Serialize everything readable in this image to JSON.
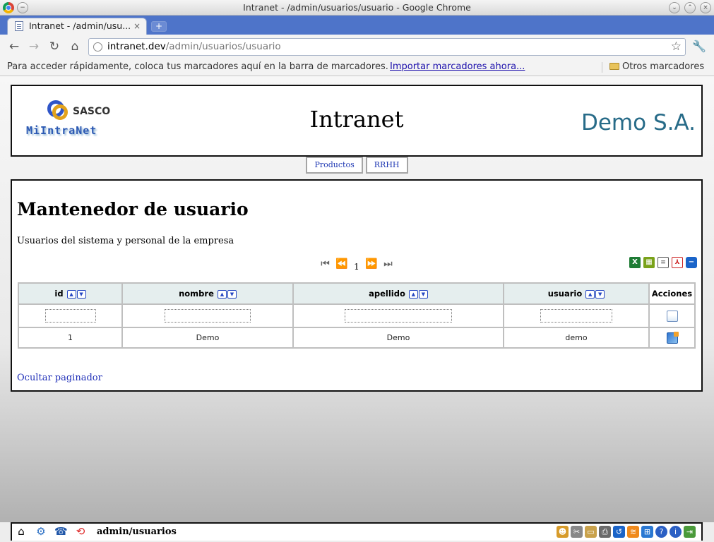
{
  "window": {
    "title": "Intranet - /admin/usuarios/usuario - Google Chrome"
  },
  "tab": {
    "label": "Intranet - /admin/usu...",
    "close": "×",
    "new_tab": "+"
  },
  "omnibox": {
    "host": "intranet.dev",
    "path": "/admin/usuarios/usuario"
  },
  "bookmarks": {
    "hint": "Para acceder rápidamente, coloca tus marcadores aquí en la barra de marcadores.",
    "import_link": "Importar marcadores ahora...",
    "other_folder": "Otros marcadores"
  },
  "header": {
    "logo_top": "SASCO",
    "logo_bottom": "MiIntraNet",
    "site_title": "Intranet",
    "company": "Demo S.A."
  },
  "menu": {
    "items": [
      {
        "label": "Productos"
      },
      {
        "label": "RRHH"
      }
    ]
  },
  "page": {
    "title": "Mantenedor de usuario",
    "description": "Usuarios del sistema y personal de la empresa",
    "toggle_pager": "Ocultar paginador"
  },
  "pager": {
    "current_page": "1"
  },
  "table": {
    "columns": [
      "id",
      "nombre",
      "apellido",
      "usuario",
      "Acciones"
    ],
    "rows": [
      [
        "1",
        "Demo",
        "Demo",
        "demo"
      ]
    ]
  },
  "statusbar": {
    "path": "admin/usuarios"
  },
  "colors": {
    "company": "#276b88",
    "link": "#1f2fb8",
    "header_cell": "#e5eeee",
    "tab_strip": "#4e74c9"
  }
}
